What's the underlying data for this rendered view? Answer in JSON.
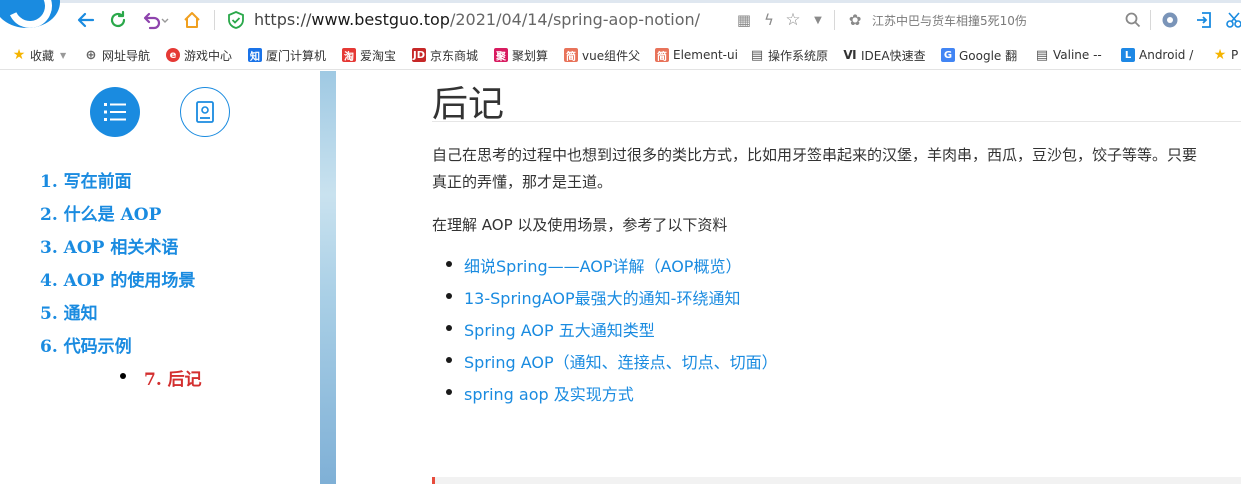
{
  "browser": {
    "url_scheme": "https://",
    "url_host": "www.bestguo.top",
    "url_path": "/2021/04/14/spring-aop-notion/",
    "hot_search": "江苏中巴与货车相撞5死10伤"
  },
  "bookmarks": [
    {
      "label": "收藏",
      "icon": "star-icon",
      "color": "#f5b400"
    },
    {
      "label": "网址导航",
      "icon": "globe-icon",
      "color": "#666666"
    },
    {
      "label": "游戏中心",
      "icon": "game-icon",
      "color": "#e53935"
    },
    {
      "label": "厦门计算机",
      "icon": "zhihu-icon",
      "color": "#1a73e8"
    },
    {
      "label": "爱淘宝",
      "icon": "taobao-icon",
      "color": "#e53935"
    },
    {
      "label": "京东商城",
      "icon": "jd-icon",
      "color": "#c62828"
    },
    {
      "label": "聚划算",
      "icon": "juhuasuan-icon",
      "color": "#d81b60"
    },
    {
      "label": "vue组件父",
      "icon": "jianshu-icon",
      "color": "#e8735a"
    },
    {
      "label": "Element-ui",
      "icon": "jianshu-icon",
      "color": "#e8735a"
    },
    {
      "label": "操作系统原",
      "icon": "doc-icon",
      "color": "#555555"
    },
    {
      "label": "IDEA快速查",
      "icon": "idea-icon",
      "color": "#333333"
    },
    {
      "label": "Google 翻",
      "icon": "google-translate-icon",
      "color": "#4285f4"
    },
    {
      "label": "Valine --",
      "icon": "doc-icon",
      "color": "#555555"
    },
    {
      "label": "Android /",
      "icon": "letter-l-icon",
      "color": "#1e88e5"
    },
    {
      "label": "P",
      "icon": "star-icon",
      "color": "#f5b400"
    }
  ],
  "toc": {
    "items": [
      "1. 写在前面",
      "2. 什么是 AOP",
      "3. AOP 相关术语",
      "4. AOP 的使用场景",
      "5. 通知",
      "6. 代码示例"
    ],
    "current": "7. 后记"
  },
  "article": {
    "heading": "后记",
    "para1_line1": "自己在思考的过程中也想到过很多的类比方式，比如用牙签串起来的汉堡，羊肉串，西瓜，豆沙包，饺子等等。只要",
    "para1_line2": "真正的弄懂，那才是王道。",
    "para2": "在理解 AOP 以及使用场景，参考了以下资料",
    "references": [
      "细说Spring——AOP详解（AOP概览）",
      "13-SpringAOP最强大的通知-环绕通知",
      "Spring AOP 五大通知类型",
      "Spring AOP（通知、连接点、切点、切面）",
      "spring aop 及实现方式"
    ]
  },
  "colors": {
    "accent": "#1a8be0",
    "active_toc": "#d32f2f",
    "secure_lock": "#2aa84a"
  }
}
